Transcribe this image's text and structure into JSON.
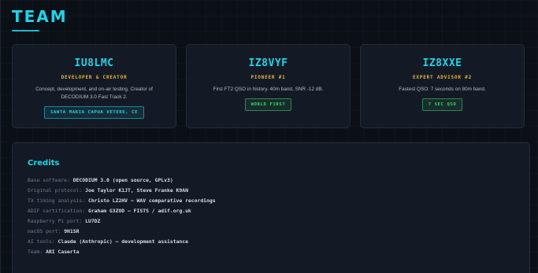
{
  "page": {
    "title": "TEAM"
  },
  "cards": [
    {
      "callsign": "IU8LMC",
      "role": "DEVELOPER & CREATOR",
      "description": "Concept, development, and on-air testing. Creator of DECODIUM 3.0 Fast Track 2.",
      "badge": "SANTA MARIA CAPUA VETERE, CE",
      "badge_color": "#20d3e8"
    },
    {
      "callsign": "IZ8VYF",
      "role": "PIONEER #1",
      "description": "First FT2 QSO in history. 40m band, SNR -12 dB.",
      "badge": "WORLD FIRST",
      "badge_color": "#3fd46a"
    },
    {
      "callsign": "IZ8XXE",
      "role": "EXPERT ADVISOR #2",
      "description": "Fastest QSO: 7 seconds on 80m band.",
      "badge": "7 SEC QSO",
      "badge_color": "#3fd46a"
    }
  ],
  "credits": {
    "title": "Credits",
    "rows": [
      {
        "label": "Base software:",
        "value": "DECODIUM 3.0 (open source, GPLv3)"
      },
      {
        "label": "Original protocol:",
        "value": "Joe Taylor K1JT, Steve Franke K9AN"
      },
      {
        "label": "TX timing analysis:",
        "value": "Christo LZ2HV — WAV comparative recordings"
      },
      {
        "label": "ADIF certification:",
        "value": "Graham G3ZOD — FISTS / adif.org.uk"
      },
      {
        "label": "Raspberry Pi port:",
        "value": "LU7DZ"
      },
      {
        "label": "macOS port:",
        "value": "9H1SR"
      },
      {
        "label": "AI tools:",
        "value": "Claude (Anthropic) — development assistance"
      },
      {
        "label": "Team:",
        "value": "ARI Caserta"
      }
    ]
  },
  "colors": {
    "accent": "#20d3e8",
    "role": "#e3b341",
    "success": "#3fd46a",
    "background": "#0b0f16"
  }
}
